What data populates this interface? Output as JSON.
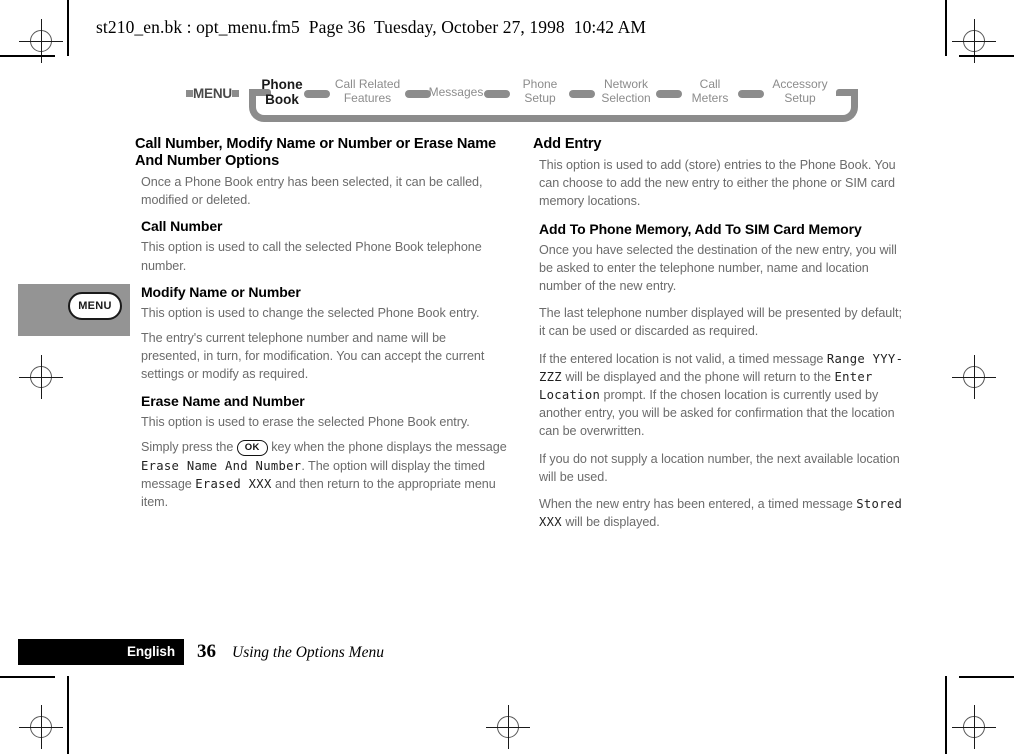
{
  "header": {
    "text": "st210_en.bk : opt_menu.fm5  Page 36  Tuesday, October 27, 1998  10:42 AM"
  },
  "nav": {
    "root_label": "MENU",
    "items": [
      {
        "label": "Phone\nBook",
        "active": true
      },
      {
        "label": "Call Related\nFeatures",
        "active": false
      },
      {
        "label": "Messages",
        "active": false
      },
      {
        "label": "Phone\nSetup",
        "active": false
      },
      {
        "label": "Network\nSelection",
        "active": false
      },
      {
        "label": "Call\nMeters",
        "active": false
      },
      {
        "label": "Accessory\nSetup",
        "active": false
      }
    ]
  },
  "margin_tab": {
    "key_label": "MENU"
  },
  "left_column": {
    "section_title": "Call Number, Modify Name or Number or Erase Name And Number Options",
    "intro": "Once a Phone Book entry has been selected, it can be called, modified or deleted.",
    "sub1_title": "Call Number",
    "sub1_body": "This option is used to call the selected Phone Book telephone number.",
    "sub2_title": "Modify Name or Number",
    "sub2_body1": "This option is used to change the selected Phone Book entry.",
    "sub2_body2": "The entry's current telephone number and name will be presented, in turn, for modification. You can accept the current settings or modify as required.",
    "sub3_title": "Erase Name and Number",
    "sub3_body1": "This option is used to erase the selected Phone Book entry.",
    "sub3_para2": {
      "part1": "Simply press the ",
      "key": "OK",
      "part2": " key when the phone displays the message ",
      "lcd1": "Erase Name And Number",
      "part3": ". The option will display the timed message ",
      "lcd2": "Erased XXX",
      "part4": " and then return to the appropriate menu item."
    }
  },
  "right_column": {
    "section_title": "Add Entry",
    "intro": "This option is used to add (store) entries to the Phone Book. You can choose to add the new entry to either the phone or SIM card memory locations.",
    "sub1_title": "Add To Phone Memory, Add To SIM Card Memory",
    "sub1_body1": "Once you have selected the destination of the new entry, you will be asked to enter the telephone number, name and location number of the new entry.",
    "sub1_body2": "The last telephone number displayed will be presented by default; it can be used or discarded as required.",
    "sub1_para3": {
      "part1": "If the entered location is not valid, a timed message ",
      "lcd1": "Range YYY-ZZZ",
      "part2": " will be displayed and the phone will return to the ",
      "lcd2": "Enter Location",
      "part3": " prompt. If the chosen location is currently used by another entry, you will be asked for confirmation that the location can be overwritten."
    },
    "sub1_body4": "If you do not supply a location number, the next available location will be used.",
    "sub1_para5": {
      "part1": "When the new entry has been entered, a timed message ",
      "lcd1": "Stored XXX",
      "part2": " will be displayed."
    }
  },
  "footer": {
    "language": "English",
    "page_number": "36",
    "chapter": "Using the Options Menu"
  },
  "colors": {
    "nav_gray": "#8c8c8c",
    "body_gray": "#6b6b6b",
    "tab_gray": "#949494",
    "ink": "#000000"
  }
}
